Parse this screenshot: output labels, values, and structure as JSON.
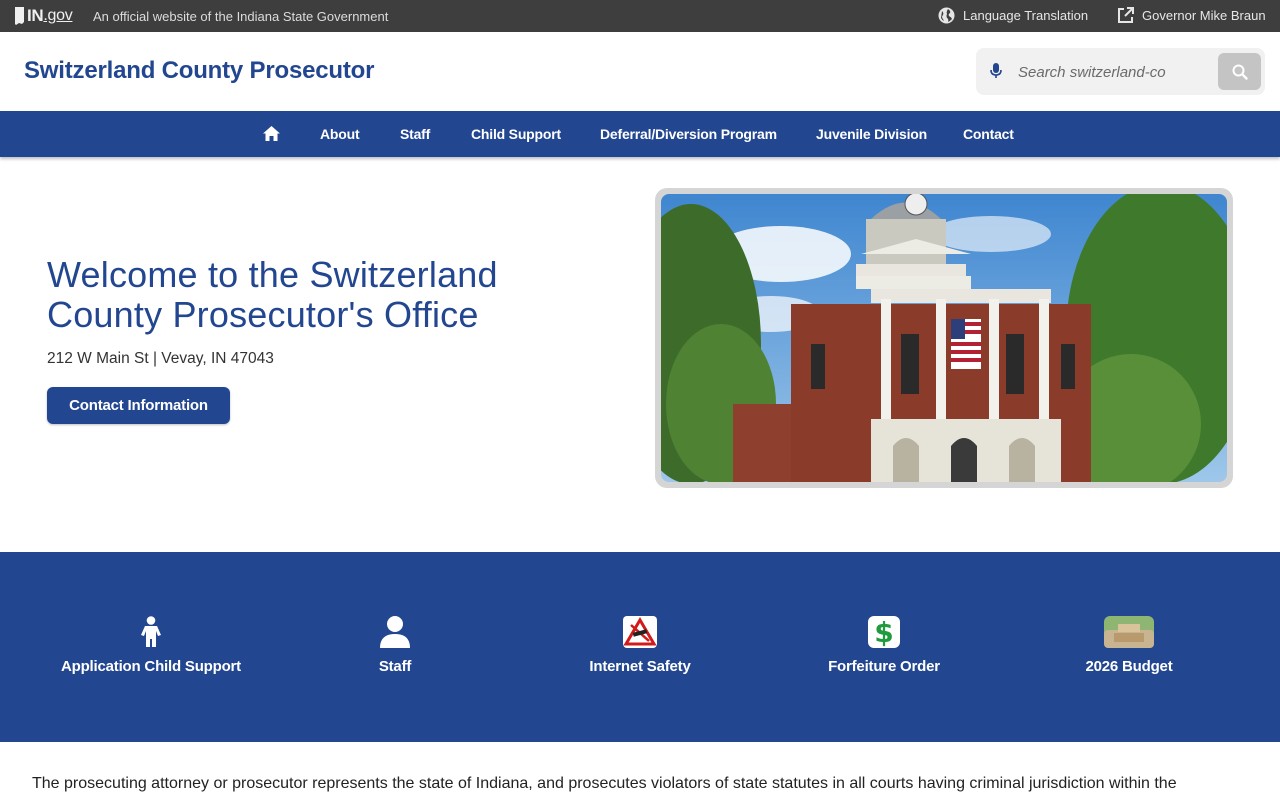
{
  "topbar": {
    "logo_in": "IN",
    "logo_gov": ".gov",
    "official_text": "An official website of the Indiana State Government",
    "language_label": "Language Translation",
    "governor_label": "Governor Mike Braun"
  },
  "header": {
    "site_title": "Switzerland County Prosecutor",
    "search_placeholder": "Search switzerland-co"
  },
  "nav": {
    "items": [
      {
        "label": "About"
      },
      {
        "label": "Staff"
      },
      {
        "label": "Child Support"
      },
      {
        "label": "Deferral/Diversion Program"
      },
      {
        "label": "Juvenile Division"
      },
      {
        "label": "Contact"
      }
    ]
  },
  "hero": {
    "title": "Welcome to the Switzerland County Prosecutor's Office",
    "address": "212 W Main St | Vevay, IN 47043",
    "button_label": "Contact Information"
  },
  "quick_links": [
    {
      "label": "Application Child Support",
      "icon": "child-icon"
    },
    {
      "label": "Staff",
      "icon": "person-icon"
    },
    {
      "label": "Internet Safety",
      "icon": "internet-safety-icon"
    },
    {
      "label": "Forfeiture Order",
      "icon": "dollar-icon"
    },
    {
      "label": "2026 Budget",
      "icon": "budget-icon"
    }
  ],
  "intro_text": "The prosecuting attorney or prosecutor represents the state of Indiana, and prosecutes violators of state statutes in all courts having criminal jurisdiction within the",
  "colors": {
    "brand_blue": "#22468f",
    "topbar": "#3e3e3e"
  }
}
